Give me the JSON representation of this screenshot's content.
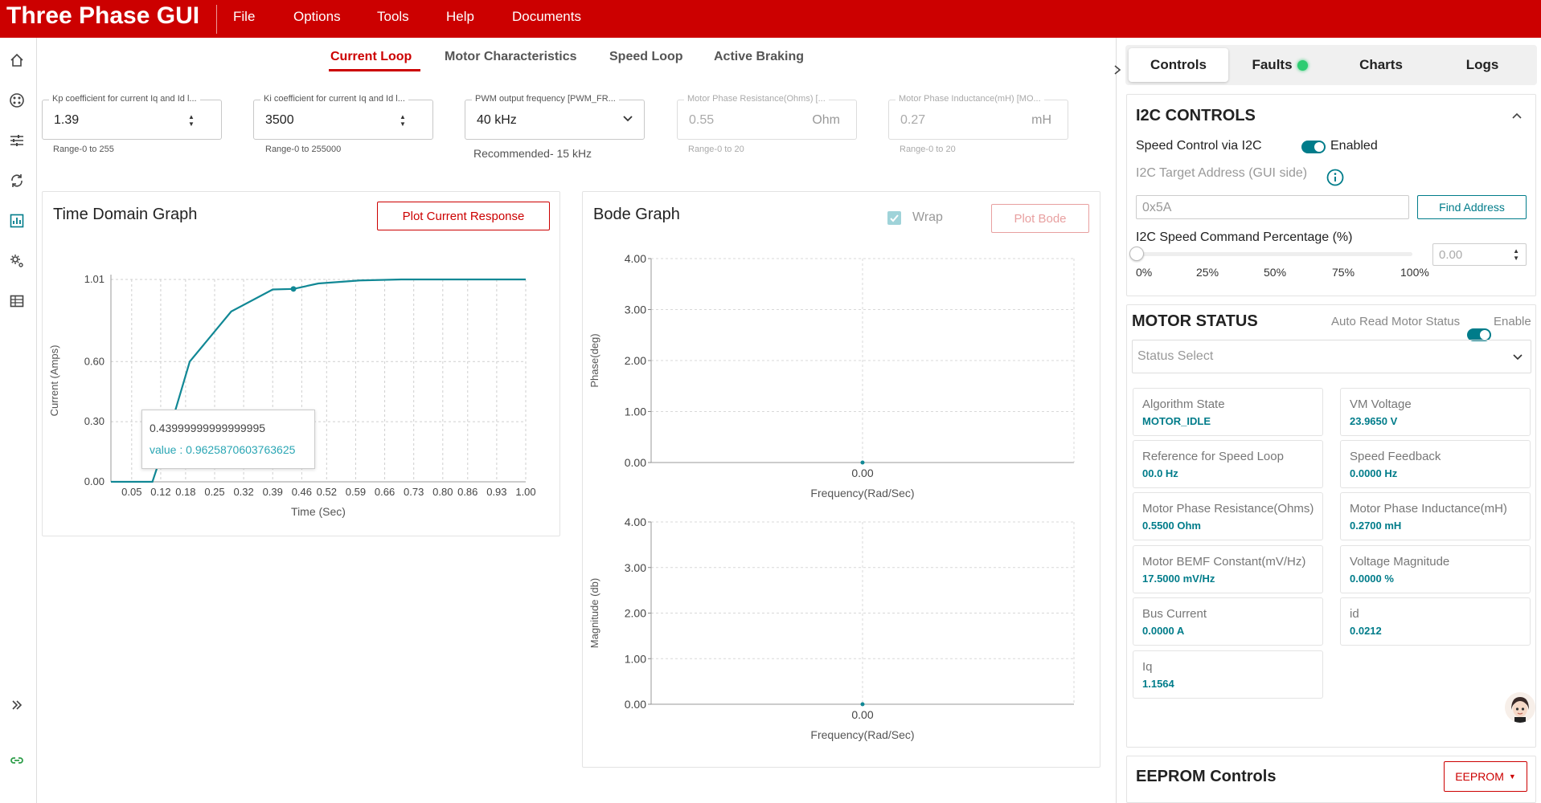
{
  "app": {
    "title": "Three Phase GUI",
    "menu": [
      "File",
      "Options",
      "Tools",
      "Help",
      "Documents"
    ]
  },
  "colors": {
    "brand": "#cc0000",
    "accent": "#007c8a",
    "status_ok": "#2ecc71"
  },
  "rail": {
    "icons": [
      "home-icon",
      "palette-icon",
      "tune-icon",
      "sync-icon",
      "chart-icon",
      "settings-gear-icon",
      "table-icon",
      "expand-icon",
      "link-icon"
    ]
  },
  "tabs": [
    "Current Loop",
    "Motor Characteristics",
    "Speed Loop",
    "Active Braking"
  ],
  "active_tab": "Current Loop",
  "fields": {
    "kp": {
      "label": "Kp coefficient for current Iq and Id l...",
      "value": "1.39",
      "helper": "Range-0 to 255"
    },
    "ki": {
      "label": "Ki coefficient for current Iq and Id l...",
      "value": "3500",
      "helper": "Range-0 to 255000"
    },
    "pwm": {
      "label": "PWM output frequency [PWM_FR...",
      "value": "40 kHz",
      "helper": "Recommended- 15 kHz"
    },
    "res": {
      "label": "Motor Phase Resistance(Ohms) [...",
      "value": "0.55",
      "unit": "Ohm",
      "helper": "Range-0 to 20"
    },
    "ind": {
      "label": "Motor Phase Inductance(mH) [MO...",
      "value": "0.27",
      "unit": "mH",
      "helper": "Range-0 to 20"
    }
  },
  "time_graph": {
    "title": "Time Domain Graph",
    "button": "Plot Current Response",
    "tooltip": {
      "x": "0.43999999999999995",
      "value": "value : 0.9625870603763625"
    }
  },
  "bode": {
    "title": "Bode Graph",
    "wrap_label": "Wrap",
    "button": "Plot Bode"
  },
  "chart_data": [
    {
      "type": "line",
      "title": "Time Domain Graph",
      "xlabel": "Time (Sec)",
      "ylabel": "Current (Amps)",
      "xlim": [
        0,
        1.0
      ],
      "ylim": [
        0,
        1.01
      ],
      "x_ticks": [
        "0.05",
        "0.12",
        "0.18",
        "0.25",
        "0.32",
        "0.39",
        "0.46",
        "0.52",
        "0.59",
        "0.66",
        "0.73",
        "0.80",
        "0.86",
        "0.93",
        "1.00"
      ],
      "y_ticks": [
        "0.00",
        "0.30",
        "0.60",
        "1.01"
      ],
      "grid": true,
      "x": [
        0,
        0.1,
        0.14,
        0.19,
        0.29,
        0.39,
        0.44,
        0.5,
        0.6,
        0.7,
        0.8,
        0.9,
        1.0
      ],
      "values": [
        0,
        0,
        0.25,
        0.6,
        0.85,
        0.96,
        0.9626,
        0.99,
        1.005,
        1.01,
        1.01,
        1.01,
        1.01
      ]
    },
    {
      "type": "line",
      "xlabel": "Frequency(Rad/Sec)",
      "ylabel": "Phase(deg)",
      "ylim": [
        0,
        4.0
      ],
      "x_ticks": [
        "0.00"
      ],
      "y_ticks": [
        "0.00",
        "1.00",
        "2.00",
        "3.00",
        "4.00"
      ],
      "grid": true,
      "x": [
        0
      ],
      "values": [
        0
      ]
    },
    {
      "type": "line",
      "xlabel": "Frequency(Rad/Sec)",
      "ylabel": "Magnitude (db)",
      "ylim": [
        0,
        4.0
      ],
      "x_ticks": [
        "0.00"
      ],
      "y_ticks": [
        "0.00",
        "1.00",
        "2.00",
        "3.00",
        "4.00"
      ],
      "grid": true,
      "x": [
        0
      ],
      "values": [
        0
      ]
    }
  ],
  "right": {
    "tabs": [
      "Controls",
      "Faults",
      "Charts",
      "Logs"
    ],
    "i2c": {
      "title": "I2C CONTROLS",
      "speed_control_label": "Speed Control via I2C",
      "speed_control_state": "Enabled",
      "target_label": "I2C Target Address (GUI side)",
      "address_placeholder": "0x5A",
      "find_button": "Find Address",
      "speed_pct_label": "I2C Speed Command Percentage (%)",
      "speed_pct_value": "0.00",
      "slider_value": 0,
      "ticks": [
        "0%",
        "25%",
        "50%",
        "75%",
        "100%"
      ]
    },
    "motor_status": {
      "title": "MOTOR STATUS",
      "auto_read_label": "Auto Read Motor Status",
      "auto_read_state": "Enable",
      "select_placeholder": "Status Select",
      "cards": [
        {
          "label": "Algorithm State",
          "value": "MOTOR_IDLE"
        },
        {
          "label": "VM Voltage",
          "value": "23.9650 V"
        },
        {
          "label": "Reference for Speed Loop",
          "value": "00.0 Hz"
        },
        {
          "label": "Speed Feedback",
          "value": "0.0000 Hz"
        },
        {
          "label": "Motor Phase Resistance(Ohms)",
          "value": "0.5500 Ohm"
        },
        {
          "label": "Motor Phase Inductance(mH)",
          "value": "0.2700 mH"
        },
        {
          "label": "Motor BEMF Constant(mV/Hz)",
          "value": "17.5000 mV/Hz"
        },
        {
          "label": "Voltage Magnitude",
          "value": "0.0000 %"
        },
        {
          "label": "Bus Current",
          "value": "0.0000 A"
        },
        {
          "label": "id",
          "value": "0.0212"
        },
        {
          "label": "Iq",
          "value": "1.1564"
        }
      ]
    },
    "eeprom": {
      "title": "EEPROM Controls",
      "button": "EEPROM"
    }
  }
}
